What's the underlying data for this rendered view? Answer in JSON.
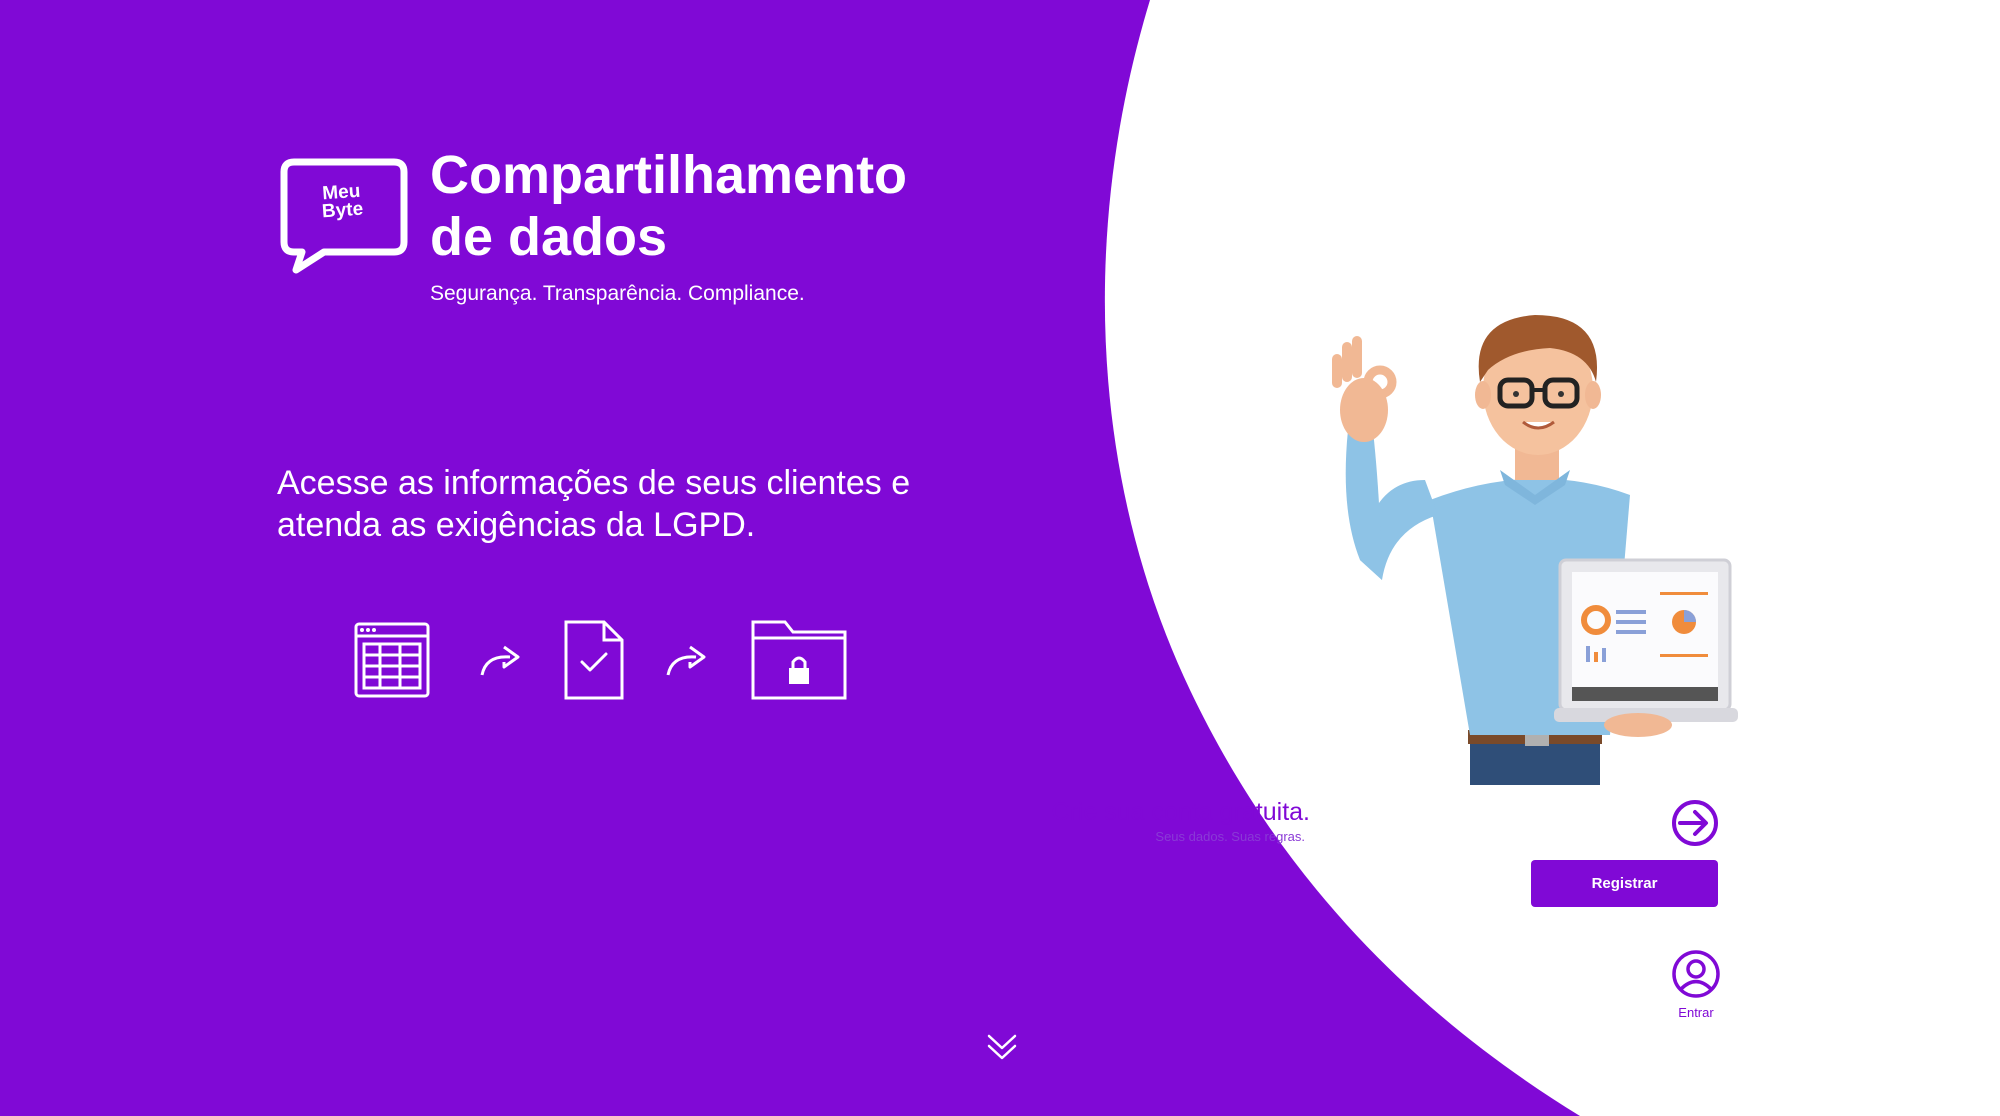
{
  "brand": {
    "logo_text_line1": "Meu",
    "logo_text_line2": "Byte",
    "primary_color": "#8009D6",
    "background_right": "#FFFFFF"
  },
  "hero": {
    "title_line1": "Compartilhamento",
    "title_line2": "de dados",
    "subtitle": "Segurança. Transparência. Compliance.",
    "lead_line1": "Acesse as informações de seus clientes e",
    "lead_line2": "atenda as exigências da LGPD."
  },
  "flow": {
    "steps": [
      "spreadsheet-icon",
      "curved-arrow-icon",
      "document-check-icon",
      "curved-arrow-icon",
      "locked-folder-icon"
    ]
  },
  "signup": {
    "headline": "Crie sua conta gratuita.",
    "tagline": "Seus dados. Suas regras.",
    "register_label": "Registrar",
    "arrow_icon": "arrow-right-circle-icon"
  },
  "login": {
    "label": "Entrar",
    "icon": "user-circle-icon"
  },
  "scroll": {
    "icon": "double-chevron-down-icon"
  }
}
